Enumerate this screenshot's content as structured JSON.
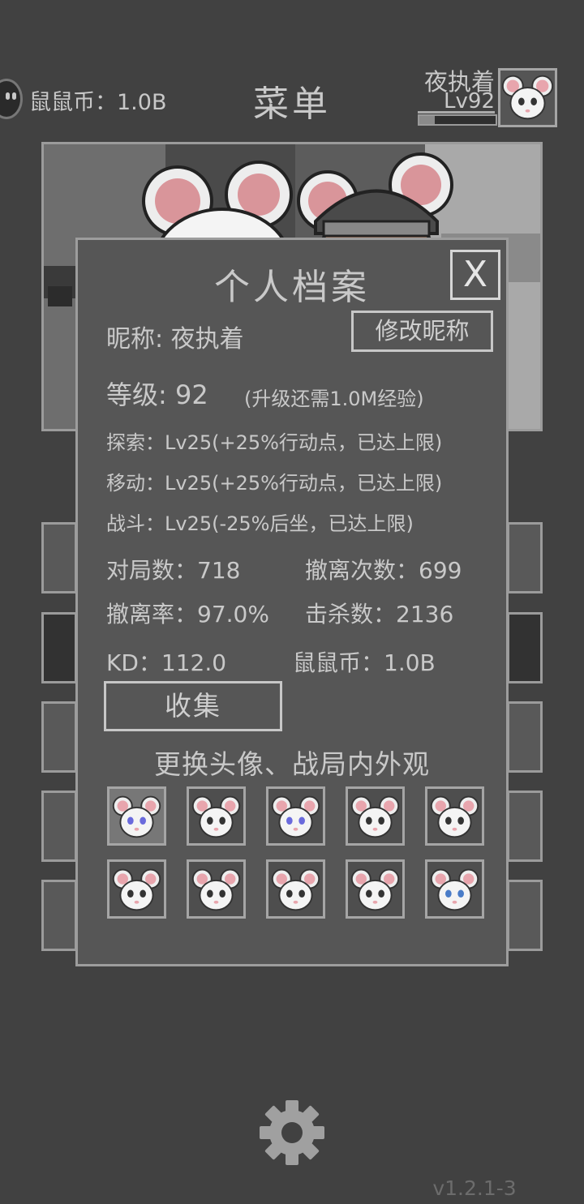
{
  "header": {
    "coin_label": "鼠鼠币：1.0B",
    "title": "菜单",
    "player_name": "夜执着",
    "player_level": "Lv92",
    "xp_progress": 0.2
  },
  "profile": {
    "title": "个人档案",
    "close_label": "X",
    "nickname_line": "昵称: 夜执着",
    "rename_button": "修改昵称",
    "level_line": "等级:  92",
    "level_hint": "(升级还需1.0M经验)",
    "explore_line": "探索：Lv25(+25%行动点，已达上限)",
    "move_line": "移动：Lv25(+25%行动点，已达上限)",
    "combat_line": "战斗：Lv25(-25%后坐，已达上限)",
    "matches": "对局数：718",
    "extractions": "撤离次数：699",
    "extract_rate": "撤离率：97.0%",
    "kills": "击杀数：2136",
    "kd": "KD：112.0",
    "coins": "鼠鼠币：1.0B",
    "collect_button": "收集",
    "skin_heading": "更换头像、战局内外观",
    "avatar_options": [
      {
        "name": "white-mouse-1",
        "eye": "#6a6adc"
      },
      {
        "name": "white-mouse-2",
        "eye": "#333333"
      },
      {
        "name": "white-mouse-3",
        "eye": "#6a6adc"
      },
      {
        "name": "white-mouse-4",
        "eye": "#333333"
      },
      {
        "name": "white-mouse-5",
        "eye": "#333333"
      },
      {
        "name": "white-mouse-6",
        "eye": "#333333"
      },
      {
        "name": "white-mouse-7",
        "eye": "#333333"
      },
      {
        "name": "white-mouse-8",
        "eye": "#333333"
      },
      {
        "name": "white-mouse-9",
        "eye": "#333333"
      },
      {
        "name": "white-mouse-10",
        "eye": "#4a7cc8"
      }
    ],
    "selected_avatar": 0
  },
  "footer": {
    "settings_icon": "gear-icon",
    "version": "v1.2.1-3"
  }
}
